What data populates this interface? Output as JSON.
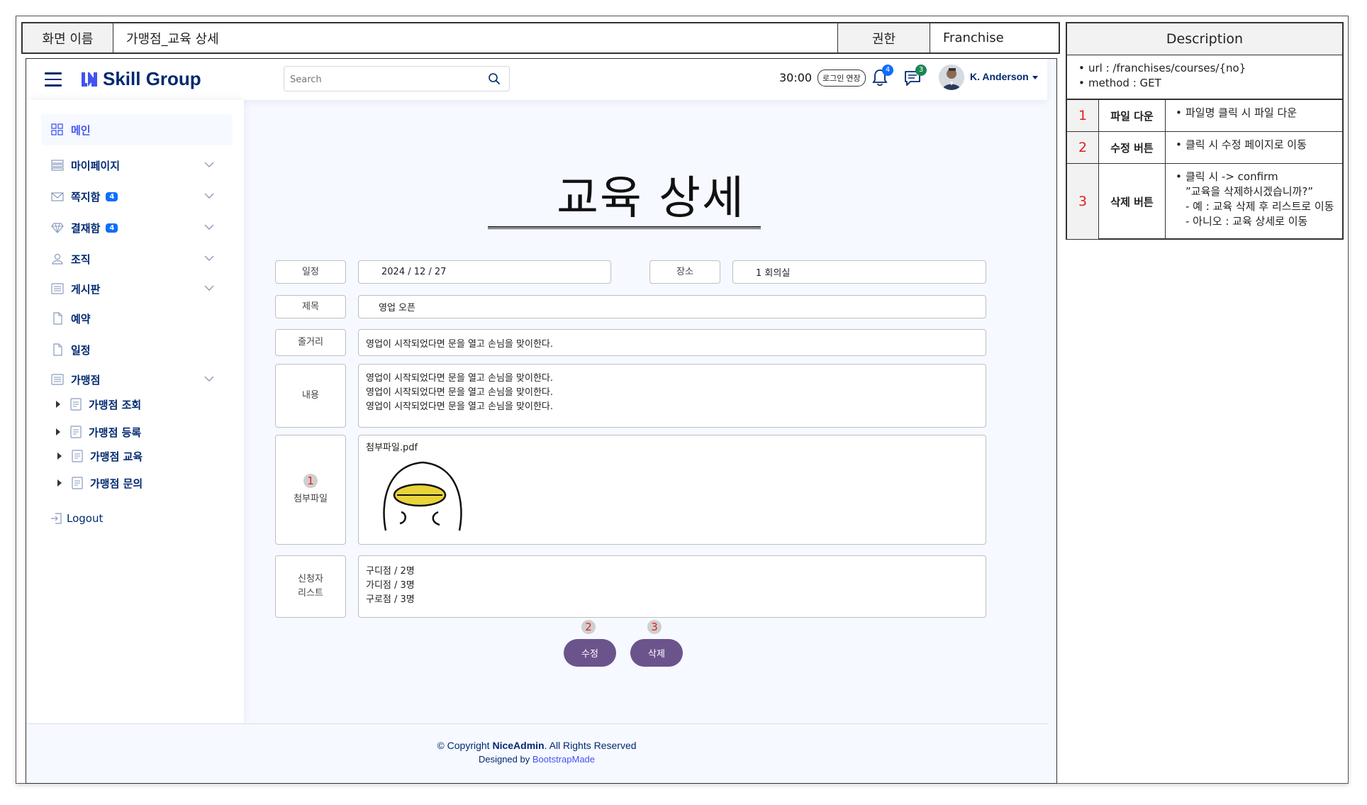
{
  "header": {
    "screen_name_label": "화면 이름",
    "screen_name_value": "가맹점_교육 상세",
    "permission_label": "권한",
    "permission_value": "Franchise"
  },
  "description": {
    "title": "Description",
    "url_line": "url :  /franchises/courses/{no}",
    "method_line": "method : GET",
    "items": [
      {
        "num": "1",
        "name": "파일 다운",
        "lines": [
          "파일명 클릭 시 파일 다운"
        ]
      },
      {
        "num": "2",
        "name": "수정 버튼",
        "lines": [
          "클릭 시 수정 페이지로 이동"
        ]
      },
      {
        "num": "3",
        "name": "삭제 버튼",
        "lines": [
          "클릭 시 -> confirm",
          "”교육을 삭제하시겠습니까?”",
          "- 예 : 교육 삭제 후 리스트로 이동",
          "- 아니오 : 교육 상세로 이동"
        ]
      }
    ]
  },
  "topbar": {
    "logo_text": "Skill Group",
    "search_placeholder": "Search",
    "timer": "30:00",
    "extend_button": "로그인 연장",
    "notification_count": "4",
    "message_count": "3",
    "user_name": "K. Anderson"
  },
  "sidebar": {
    "items": [
      {
        "label": "메인"
      },
      {
        "label": "마이페이지"
      },
      {
        "label": "쪽지함",
        "badge": "4"
      },
      {
        "label": "결재함",
        "badge": "4"
      },
      {
        "label": "조직"
      },
      {
        "label": "게시판"
      },
      {
        "label": "예약"
      },
      {
        "label": "일정"
      },
      {
        "label": "가맹점"
      }
    ],
    "sub_items": [
      "가맹점 조회",
      "가맹점 등록",
      "가맹점 교육",
      "가맹점 문의"
    ],
    "logout": "Logout"
  },
  "main": {
    "title": "교육 상세",
    "labels": {
      "schedule": "일정",
      "place": "장소",
      "subject": "제목",
      "summary": "줄거리",
      "content": "내용",
      "attachment": "첨부파일",
      "applicant_1": "신청자",
      "applicant_2": "리스트"
    },
    "values": {
      "schedule": "2024 / 12 / 27",
      "place": "1 회의실",
      "subject": "영업 오픈",
      "summary": "영업이 시작되었다면 문을 열고 손님을 맞이한다.",
      "content": [
        "영업이 시작되었다면 문을 열고 손님을 맞이한다.",
        "영업이 시작되었다면 문을 열고 손님을 맞이한다.",
        "영업이 시작되었다면 문을 열고 손님을 맞이한다."
      ],
      "attachment_name": "첨부파일.pdf",
      "applicants": [
        "구디점 / 2명",
        "가디점 / 3명",
        "구로점 / 3명"
      ]
    },
    "markers": {
      "one": "1",
      "two": "2",
      "three": "3"
    },
    "edit_button": "수정",
    "delete_button": "삭제"
  },
  "footer": {
    "copyright_prefix": "© Copyright ",
    "copyright_brand": "NiceAdmin",
    "copyright_suffix": ". All Rights Reserved",
    "designed_prefix": "Designed by ",
    "designed_link": "BootstrapMade"
  },
  "colors": {
    "brand": "#012970",
    "button": "#6b548c",
    "marker_red": "#e02020",
    "notification_badge": "#0d6efd",
    "message_badge": "#198754"
  }
}
